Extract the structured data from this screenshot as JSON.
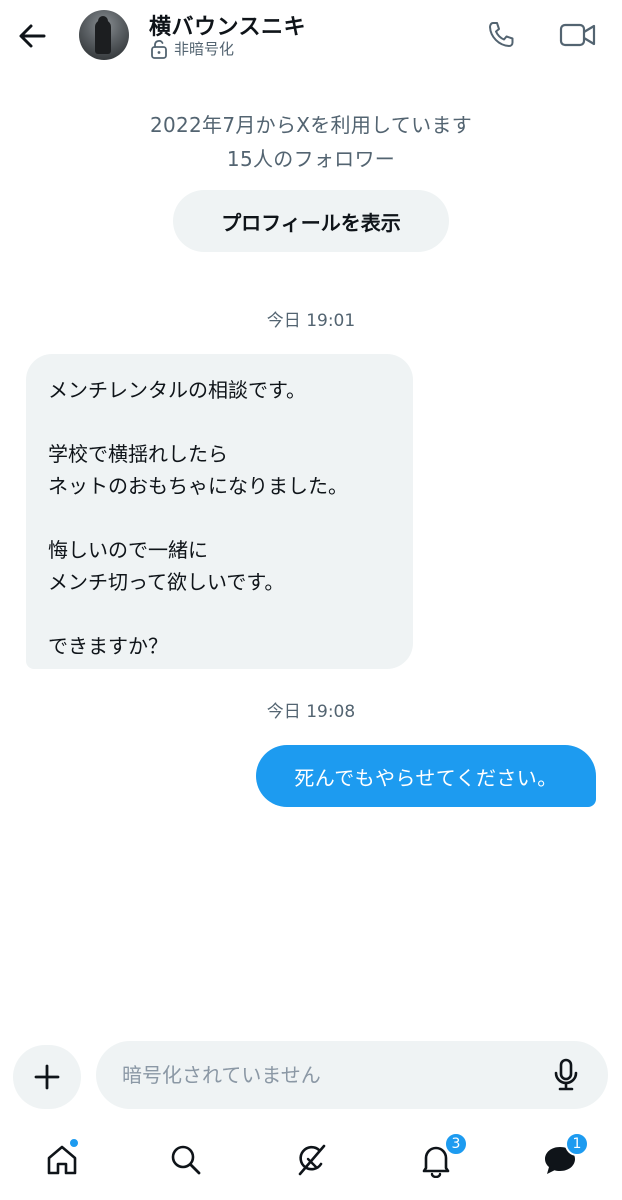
{
  "header": {
    "name": "横バウンスニキ",
    "encryption_status": "非暗号化"
  },
  "profile": {
    "joined": "2022年7月からXを利用しています",
    "followers": "15人のフォロワー",
    "view_profile_label": "プロフィールを表示"
  },
  "messages": [
    {
      "timestamp": "今日 19:01",
      "direction": "incoming",
      "text": "メンチレンタルの相談です。\n\n学校で横揺れしたら\nネットのおもちゃになりました。\n\n悔しいので一緒に\nメンチ切って欲しいです。\n\nできますか？"
    },
    {
      "timestamp": "今日 19:08",
      "direction": "outgoing",
      "text": "死んでもやらせてください。"
    }
  ],
  "composer": {
    "placeholder": "暗号化されていません",
    "value": ""
  },
  "nav": {
    "notifications_badge": "3",
    "messages_badge": "1"
  },
  "colors": {
    "accent": "#1d9bf0",
    "bubble_incoming": "#eff3f4",
    "secondary_text": "#536471"
  },
  "icons": [
    "back-arrow-icon",
    "unlock-icon",
    "phone-icon",
    "video-icon",
    "plus-icon",
    "microphone-icon",
    "home-icon",
    "search-icon",
    "grok-icon",
    "bell-icon",
    "messages-icon"
  ]
}
